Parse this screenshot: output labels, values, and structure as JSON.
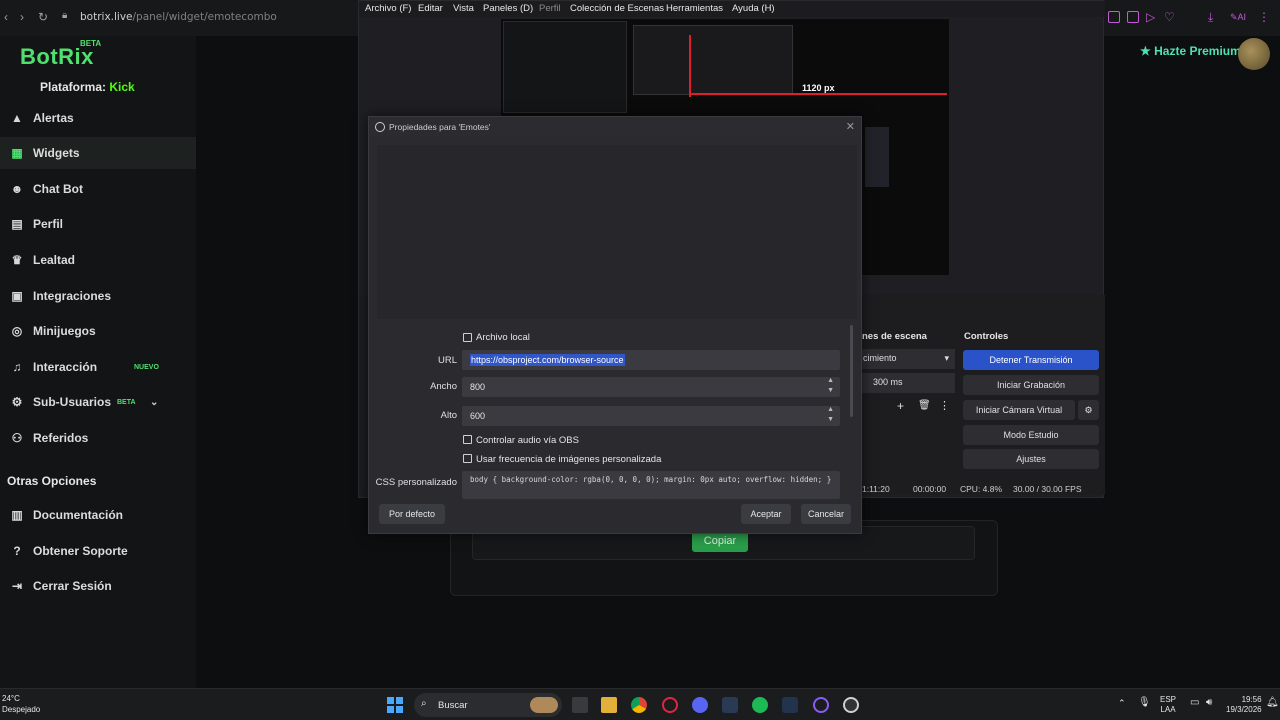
{
  "browser": {
    "url_host": "botrix.live",
    "url_path": "/panel/widget/emotecombo"
  },
  "sidebar": {
    "logo": "BotRix",
    "logo_badge": "BETA",
    "platform_label": "Plataforma:",
    "platform_value": "Kick",
    "items": [
      {
        "label": "Alertas",
        "icon": "warning-icon"
      },
      {
        "label": "Widgets",
        "icon": "widgets-grid-icon",
        "active": true
      },
      {
        "label": "Chat Bot",
        "icon": "robot-icon"
      },
      {
        "label": "Perfil",
        "icon": "id-card-icon"
      },
      {
        "label": "Lealtad",
        "icon": "trophy-icon"
      },
      {
        "label": "Integraciones",
        "icon": "integrations-icon"
      },
      {
        "label": "Minijuegos",
        "icon": "gamepad-icon"
      },
      {
        "label": "Interacción",
        "icon": "music-note-icon",
        "badge": "NUEVO"
      },
      {
        "label": "Sub-Usuarios",
        "icon": "users-icon",
        "badge": "BETA"
      },
      {
        "label": "Referidos",
        "icon": "referrals-icon"
      }
    ],
    "section_other": "Otras Opciones",
    "other_items": [
      {
        "label": "Documentación",
        "icon": "document-icon"
      },
      {
        "label": "Obtener Soporte",
        "icon": "help-icon"
      },
      {
        "label": "Cerrar Sesión",
        "icon": "logout-icon"
      }
    ]
  },
  "header": {
    "premium_label": "Hazte Premium"
  },
  "main": {
    "copy_button": "Copiar"
  },
  "obs": {
    "menu": [
      "Archivo (F)",
      "Editar",
      "Vista",
      "Paneles (D)",
      "Perfil",
      "Colección de Escenas",
      "Herramientas",
      "Ayuda (H)"
    ],
    "preview_px_label": "1120 px",
    "transitions_header": "nes de escena",
    "transition_value": "cimiento",
    "transition_duration": "300 ms",
    "controls_header": "Controles",
    "controls": [
      "Detener Transmisión",
      "Iniciar Grabación",
      "Iniciar Cámara Virtual",
      "Modo Estudio",
      "Ajustes"
    ],
    "status": {
      "live_time": "1:11:20",
      "rec_time": "00:00:00",
      "cpu": "CPU: 4.8%",
      "fps": "30.00 / 30.00 FPS"
    }
  },
  "dialog": {
    "title": "Propiedades para 'Emotes'",
    "local_file_label": "Archivo local",
    "url_label": "URL",
    "url_value": "https://obsproject.com/browser-source",
    "width_label": "Ancho",
    "width_value": "800",
    "height_label": "Alto",
    "height_value": "600",
    "audio_label": "Controlar audio vía OBS",
    "fps_label": "Usar frecuencia de imágenes personalizada",
    "css_label": "CSS personalizado",
    "css_value": "body { background-color: rgba(0, 0, 0, 0); margin: 0px auto; overflow: hidden; }",
    "defaults_button": "Por defecto",
    "ok_button": "Aceptar",
    "cancel_button": "Cancelar"
  },
  "taskbar": {
    "weather_temp": "24°C",
    "weather_desc": "Despejado",
    "search_placeholder": "Buscar",
    "lang_top": "ESP",
    "lang_bottom": "LAA",
    "time": "19:56",
    "date": "19/3/2026"
  }
}
